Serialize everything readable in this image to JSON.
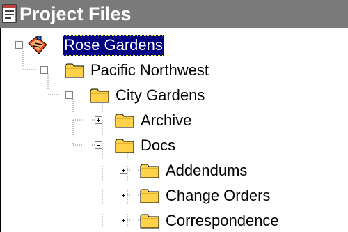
{
  "window": {
    "title": "Project Files",
    "title_icon": "project-files-icon"
  },
  "tree": {
    "selected": "Rose Gardens",
    "nodes": [
      {
        "label": "Rose Gardens",
        "expander": "minus",
        "icon": "rose-gardens-icon",
        "selected": true
      },
      {
        "label": "Pacific Northwest",
        "expander": "minus",
        "icon": "folder-icon"
      },
      {
        "label": "City Gardens",
        "expander": "minus",
        "icon": "folder-icon"
      },
      {
        "label": "Archive",
        "expander": "plus",
        "icon": "folder-icon"
      },
      {
        "label": "Docs",
        "expander": "minus",
        "icon": "folder-icon"
      },
      {
        "label": "Addendums",
        "expander": "plus",
        "icon": "folder-icon"
      },
      {
        "label": "Change Orders",
        "expander": "plus",
        "icon": "folder-icon"
      },
      {
        "label": "Correspondence",
        "expander": "plus",
        "icon": "folder-icon"
      }
    ]
  },
  "colors": {
    "titlebar_bg": "#7a7a7a",
    "title_text": "#ffffff",
    "selection_bg": "#000080",
    "selection_text": "#ffffff",
    "folder_fill": "#ffd24a"
  }
}
